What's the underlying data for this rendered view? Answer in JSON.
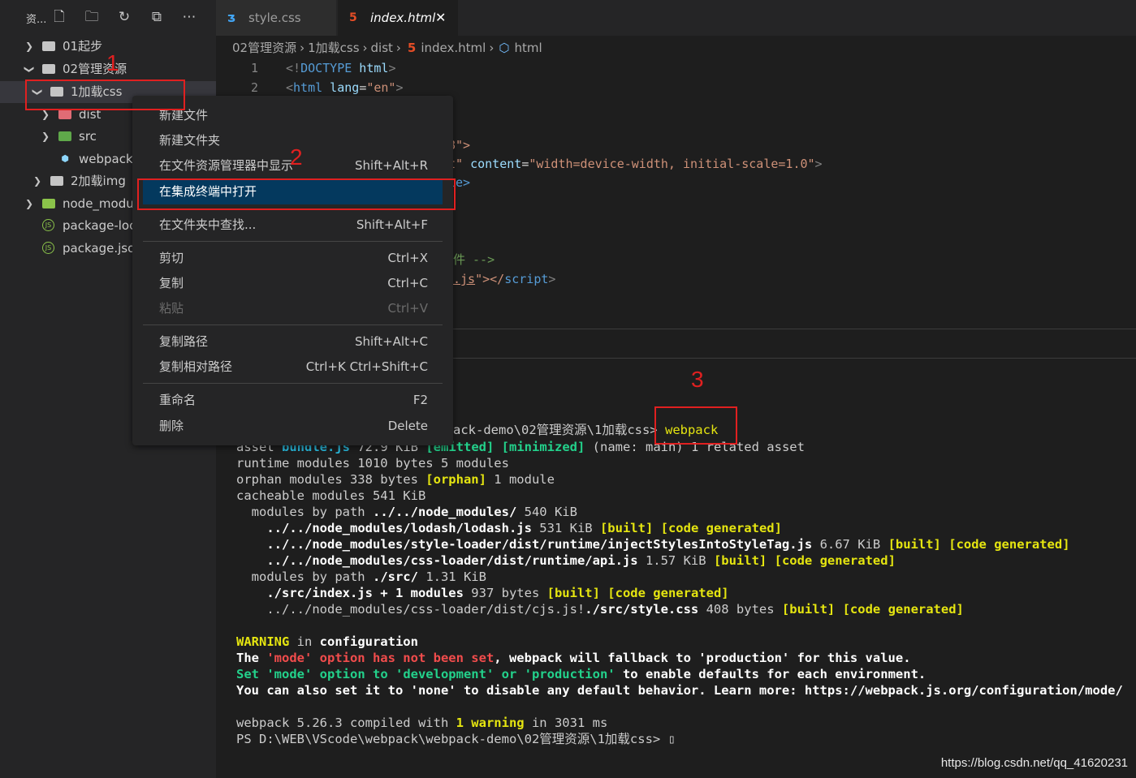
{
  "sidebar": {
    "title": "资...",
    "tree": [
      {
        "label": "01起步",
        "chevron": ">",
        "icon": "folder-icon"
      },
      {
        "label": "02管理资源",
        "chevron": "v",
        "icon": "folder-open-icon"
      },
      {
        "label": "1加载css",
        "chevron": "v",
        "icon": "folder-open-icon"
      },
      {
        "label": "dist",
        "chevron": ">",
        "icon": "folder-dist-icon"
      },
      {
        "label": "src",
        "chevron": ">",
        "icon": "folder-src-icon"
      },
      {
        "label": "webpack.",
        "chevron": "",
        "icon": "webpack-icon"
      },
      {
        "label": "2加载img",
        "chevron": ">",
        "icon": "folder-icon"
      },
      {
        "label": "node_modu",
        "chevron": ">",
        "icon": "folder-node-icon"
      },
      {
        "label": "package-loc",
        "chevron": "",
        "icon": "nodejs-icon"
      },
      {
        "label": "package.jsor",
        "chevron": "",
        "icon": "nodejs-icon"
      }
    ]
  },
  "tabs": {
    "style": "style.css",
    "index": "index.html",
    "close": "✕"
  },
  "breadcrumb": [
    "02管理资源",
    "1加载css",
    "dist",
    "index.html",
    "html"
  ],
  "code": {
    "l1_num": "1",
    "l2_num": "2",
    "l1_a": "<!",
    "l1_b": "DOCTYPE",
    "l1_c": " html",
    "l1_d": ">",
    "l2_a": "<",
    "l2_b": "html",
    "l2_c": " lang",
    "l2_d": "=",
    "l2_e": "\"en\"",
    "l2_f": ">",
    "l5_frag": "8\">",
    "l6_frag1": "t\" ",
    "l6_attr": "content",
    "l6_eq": "=",
    "l6_val": "\"width=device-width, initial-scale=1.0\"",
    "l6_end": ">",
    "l7_frag": "le>",
    "l11_frag": "件 -->",
    "l12_frag1": ".js",
    "l12_frag2": "\"></",
    "l12_tag": "script",
    "l12_end": ">"
  },
  "context_menu": {
    "items": [
      {
        "label": "新建文件",
        "key": ""
      },
      {
        "label": "新建文件夹",
        "key": ""
      },
      {
        "label": "在文件资源管理器中显示",
        "key": "Shift+Alt+R"
      },
      {
        "label": "在集成终端中打开",
        "key": ""
      },
      {
        "label": "在文件夹中查找...",
        "key": "Shift+Alt+F"
      },
      {
        "label": "剪切",
        "key": "Ctrl+X"
      },
      {
        "label": "复制",
        "key": "Ctrl+C"
      },
      {
        "label": "粘贴",
        "key": "Ctrl+V"
      },
      {
        "label": "复制路径",
        "key": "Shift+Alt+C"
      },
      {
        "label": "复制相对路径",
        "key": "Ctrl+K Ctrl+Shift+C"
      },
      {
        "label": "重命名",
        "key": "F2"
      },
      {
        "label": "删除",
        "key": "Delete"
      }
    ]
  },
  "terminal": {
    "cmd_prefix": "ack-demo\\02管理资源\\1加载css> ",
    "cmd": "webpack",
    "l_asset_a": "asset ",
    "l_asset_b": "bundle.js",
    "l_asset_c": " 72.9 KiB ",
    "l_asset_d": "[emitted]",
    "l_asset_e": " ",
    "l_asset_f": "[minimized]",
    "l_asset_g": " (name: main) 1 related asset",
    "l_runtime": "runtime modules 1010 bytes 5 modules",
    "l_orphan_a": "orphan modules 338 bytes ",
    "l_orphan_b": "[orphan]",
    "l_orphan_c": " 1 module",
    "l_cache": "cacheable modules 541 KiB",
    "l_mbp1_a": "  modules by path ",
    "l_mbp1_b": "../../node_modules/",
    "l_mbp1_c": " 540 KiB",
    "l_lodash_a": "    ../../",
    "l_lodash_b": "node_modules/lodash/lodash.js",
    "l_lodash_c": " 531 KiB ",
    "l_lodash_d": "[built]",
    "l_lodash_e": " ",
    "l_lodash_f": "[code generated]",
    "l_inject_a": "    ../../",
    "l_inject_b": "node_modules/style-loader/dist/runtime/injectStylesIntoStyleTag.js",
    "l_inject_c": " 6.67 KiB ",
    "l_inject_d": "[built]",
    "l_inject_e": " ",
    "l_inject_f": "[code generated]",
    "l_api_a": "    ../../",
    "l_api_b": "node_modules/css-loader/dist/runtime/api.js",
    "l_api_c": " 1.57 KiB ",
    "l_api_d": "[built]",
    "l_api_e": " ",
    "l_api_f": "[code generated]",
    "l_mbp2_a": "  modules by path ",
    "l_mbp2_b": "./src/",
    "l_mbp2_c": " 1.31 KiB",
    "l_index_a": "    ",
    "l_index_b": "./src/index.js + 1 modules",
    "l_index_c": " 937 bytes ",
    "l_index_d": "[built]",
    "l_index_e": " ",
    "l_index_f": "[code generated]",
    "l_cjs_a": "    ../../node_modules/css-loader/dist/cjs.js!",
    "l_cjs_b": "./src/style.css",
    "l_cjs_c": " 408 bytes ",
    "l_cjs_d": "[built]",
    "l_cjs_e": " ",
    "l_cjs_f": "[code generated]",
    "w_a": "WARNING",
    "w_b": " in ",
    "w_c": "configuration",
    "w2_a": "The ",
    "w2_b": "'mode' option has not been set",
    "w2_c": ", webpack will fallback to 'production' for this value.",
    "w3_a": "Set ",
    "w3_b": "'mode'",
    "w3_c": " option to ",
    "w3_d": "'development'",
    "w3_e": " or ",
    "w3_f": "'production'",
    "w3_g": " to enable defaults for each environment.",
    "w4": "You can also set it to 'none' to disable any default behavior. Learn more: https://webpack.js.org/configuration/mode/",
    "c_a": "webpack 5.26.3 compiled with ",
    "c_b": "1 warning",
    "c_c": " in 3031 ms",
    "ps": "PS D:\\WEB\\VScode\\webpack\\webpack-demo\\02管理资源\\1加载css> ",
    "cursor": "▯"
  },
  "annotations": {
    "n1": "1",
    "n2": "2",
    "n3": "3"
  },
  "watermark": "https://blog.csdn.net/qq_41620231"
}
